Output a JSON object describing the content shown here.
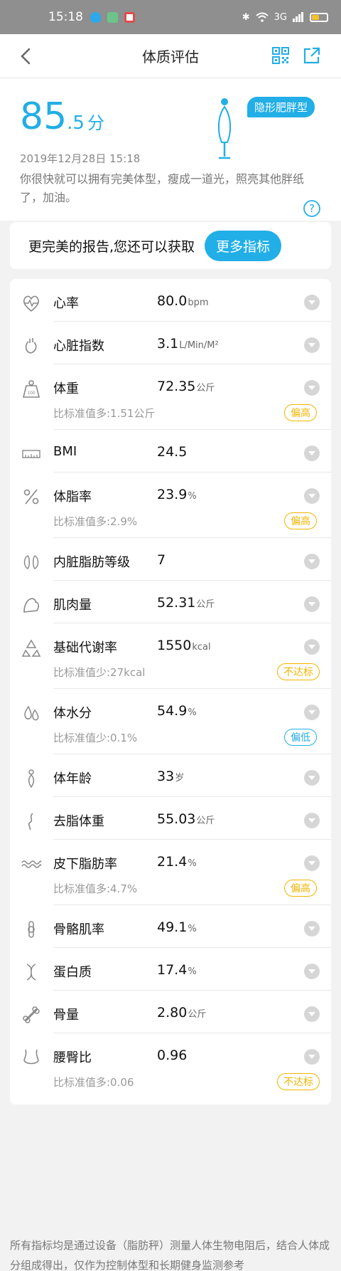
{
  "status_bar": {
    "time": "15:18",
    "network": "3G"
  },
  "nav": {
    "title": "体质评估"
  },
  "header": {
    "score_int": "85",
    "score_dec": ".5",
    "score_unit": "分",
    "date": "2019年12月28日 15:18",
    "body_type": "隐形肥胖型",
    "description": "你很快就可以拥有完美体型，瘦成一道光，照亮其他胖纸了，加油。"
  },
  "more": {
    "text": "更完美的报告,您还可以获取",
    "button": "更多指标"
  },
  "metrics": [
    {
      "icon": "heart-rate-icon",
      "name": "心率",
      "value": "80.0",
      "unit": "bpm"
    },
    {
      "icon": "heart-index-icon",
      "name": "心脏指数",
      "value": "3.1",
      "unit": "L/Min/M²"
    },
    {
      "icon": "weight-icon",
      "name": "体重",
      "value": "72.35",
      "unit": "公斤",
      "sub": "比标准值多:1.51公斤",
      "tag": "偏高",
      "tag_type": "high"
    },
    {
      "icon": "bmi-icon",
      "name": "BMI",
      "value": "24.5",
      "unit": ""
    },
    {
      "icon": "percent-icon",
      "name": "体脂率",
      "value": "23.9",
      "unit": "%",
      "sub": "比标准值多:2.9%",
      "tag": "偏高",
      "tag_type": "high"
    },
    {
      "icon": "visceral-fat-icon",
      "name": "内脏脂肪等级",
      "value": "7",
      "unit": ""
    },
    {
      "icon": "muscle-icon",
      "name": "肌肉量",
      "value": "52.31",
      "unit": "公斤"
    },
    {
      "icon": "metabolism-icon",
      "name": "基础代谢率",
      "value": "1550",
      "unit": "kcal",
      "sub": "比标准值少:27kcal",
      "tag": "不达标",
      "tag_type": "high"
    },
    {
      "icon": "water-drop-icon",
      "name": "体水分",
      "value": "54.9",
      "unit": "%",
      "sub": "比标准值少:0.1%",
      "tag": "偏低",
      "tag_type": "low"
    },
    {
      "icon": "body-age-icon",
      "name": "体年龄",
      "value": "33",
      "unit": "岁"
    },
    {
      "icon": "lean-mass-icon",
      "name": "去脂体重",
      "value": "55.03",
      "unit": "公斤"
    },
    {
      "icon": "subcutaneous-fat-icon",
      "name": "皮下脂肪率",
      "value": "21.4",
      "unit": "%",
      "sub": "比标准值多:4.7%",
      "tag": "偏高",
      "tag_type": "high"
    },
    {
      "icon": "skeletal-muscle-icon",
      "name": "骨骼肌率",
      "value": "49.1",
      "unit": "%"
    },
    {
      "icon": "protein-icon",
      "name": "蛋白质",
      "value": "17.4",
      "unit": "%"
    },
    {
      "icon": "bone-icon",
      "name": "骨量",
      "value": "2.80",
      "unit": "公斤"
    },
    {
      "icon": "waist-hip-icon",
      "name": "腰臀比",
      "value": "0.96",
      "unit": "",
      "sub": "比标准值多:0.06",
      "tag": "不达标",
      "tag_type": "high"
    }
  ],
  "footer": {
    "text": "所有指标均是通过设备（脂肪秤）测量人体生物电阻后，结合人体成分组成得出，仅作为控制体型和长期健身监测参考"
  },
  "colors": {
    "accent": "#22aee6",
    "warning": "#f2b400"
  }
}
